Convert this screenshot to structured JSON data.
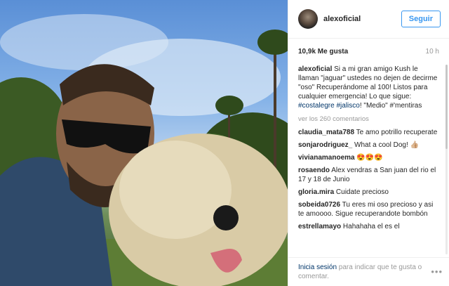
{
  "header": {
    "username": "alexoficial",
    "follow_label": "Seguir"
  },
  "meta": {
    "likes": "10,9k Me gusta",
    "time_ago": "10 h"
  },
  "caption": {
    "username": "alexoficial",
    "text": " Si a mi gran amigo Kush le llaman \"jaguar\" ustedes no dejen de decirme \"oso\" Recuperándome al 100! Listos para cualquier emergencia! Lo que sigue: ",
    "tag1": "#costalegre",
    "sep": " ",
    "tag2": "#jalisco",
    "tail": "! \"Medio\" #'mentiras"
  },
  "more_comments": "ver los 260 comentarios",
  "comments": [
    {
      "user": "claudia_mata788",
      "text": " Te amo potrillo recuperate"
    },
    {
      "user": "sonjarodriguez_",
      "text": " What a cool Dog! 👍🏼"
    },
    {
      "user": "vivianamanoema",
      "text": " 😍😍😍"
    },
    {
      "user": "rosaendo",
      "text": " Alex vendras a San juan del rio el 17 y 18 de Junio"
    },
    {
      "user": "gloria.mira",
      "text": " Cuidate precioso"
    },
    {
      "user": "sobeida0726",
      "text": " Tu eres mi oso precioso y asi te amoooo. Sigue recuperandote bombón"
    },
    {
      "user": "estrellamayo",
      "text": " Hahahaha el es el"
    }
  ],
  "footer": {
    "login_label": "Inicia sesión",
    "rest": " para indicar que te gusta o comentar.",
    "more_icon": "ellipsis-icon"
  }
}
